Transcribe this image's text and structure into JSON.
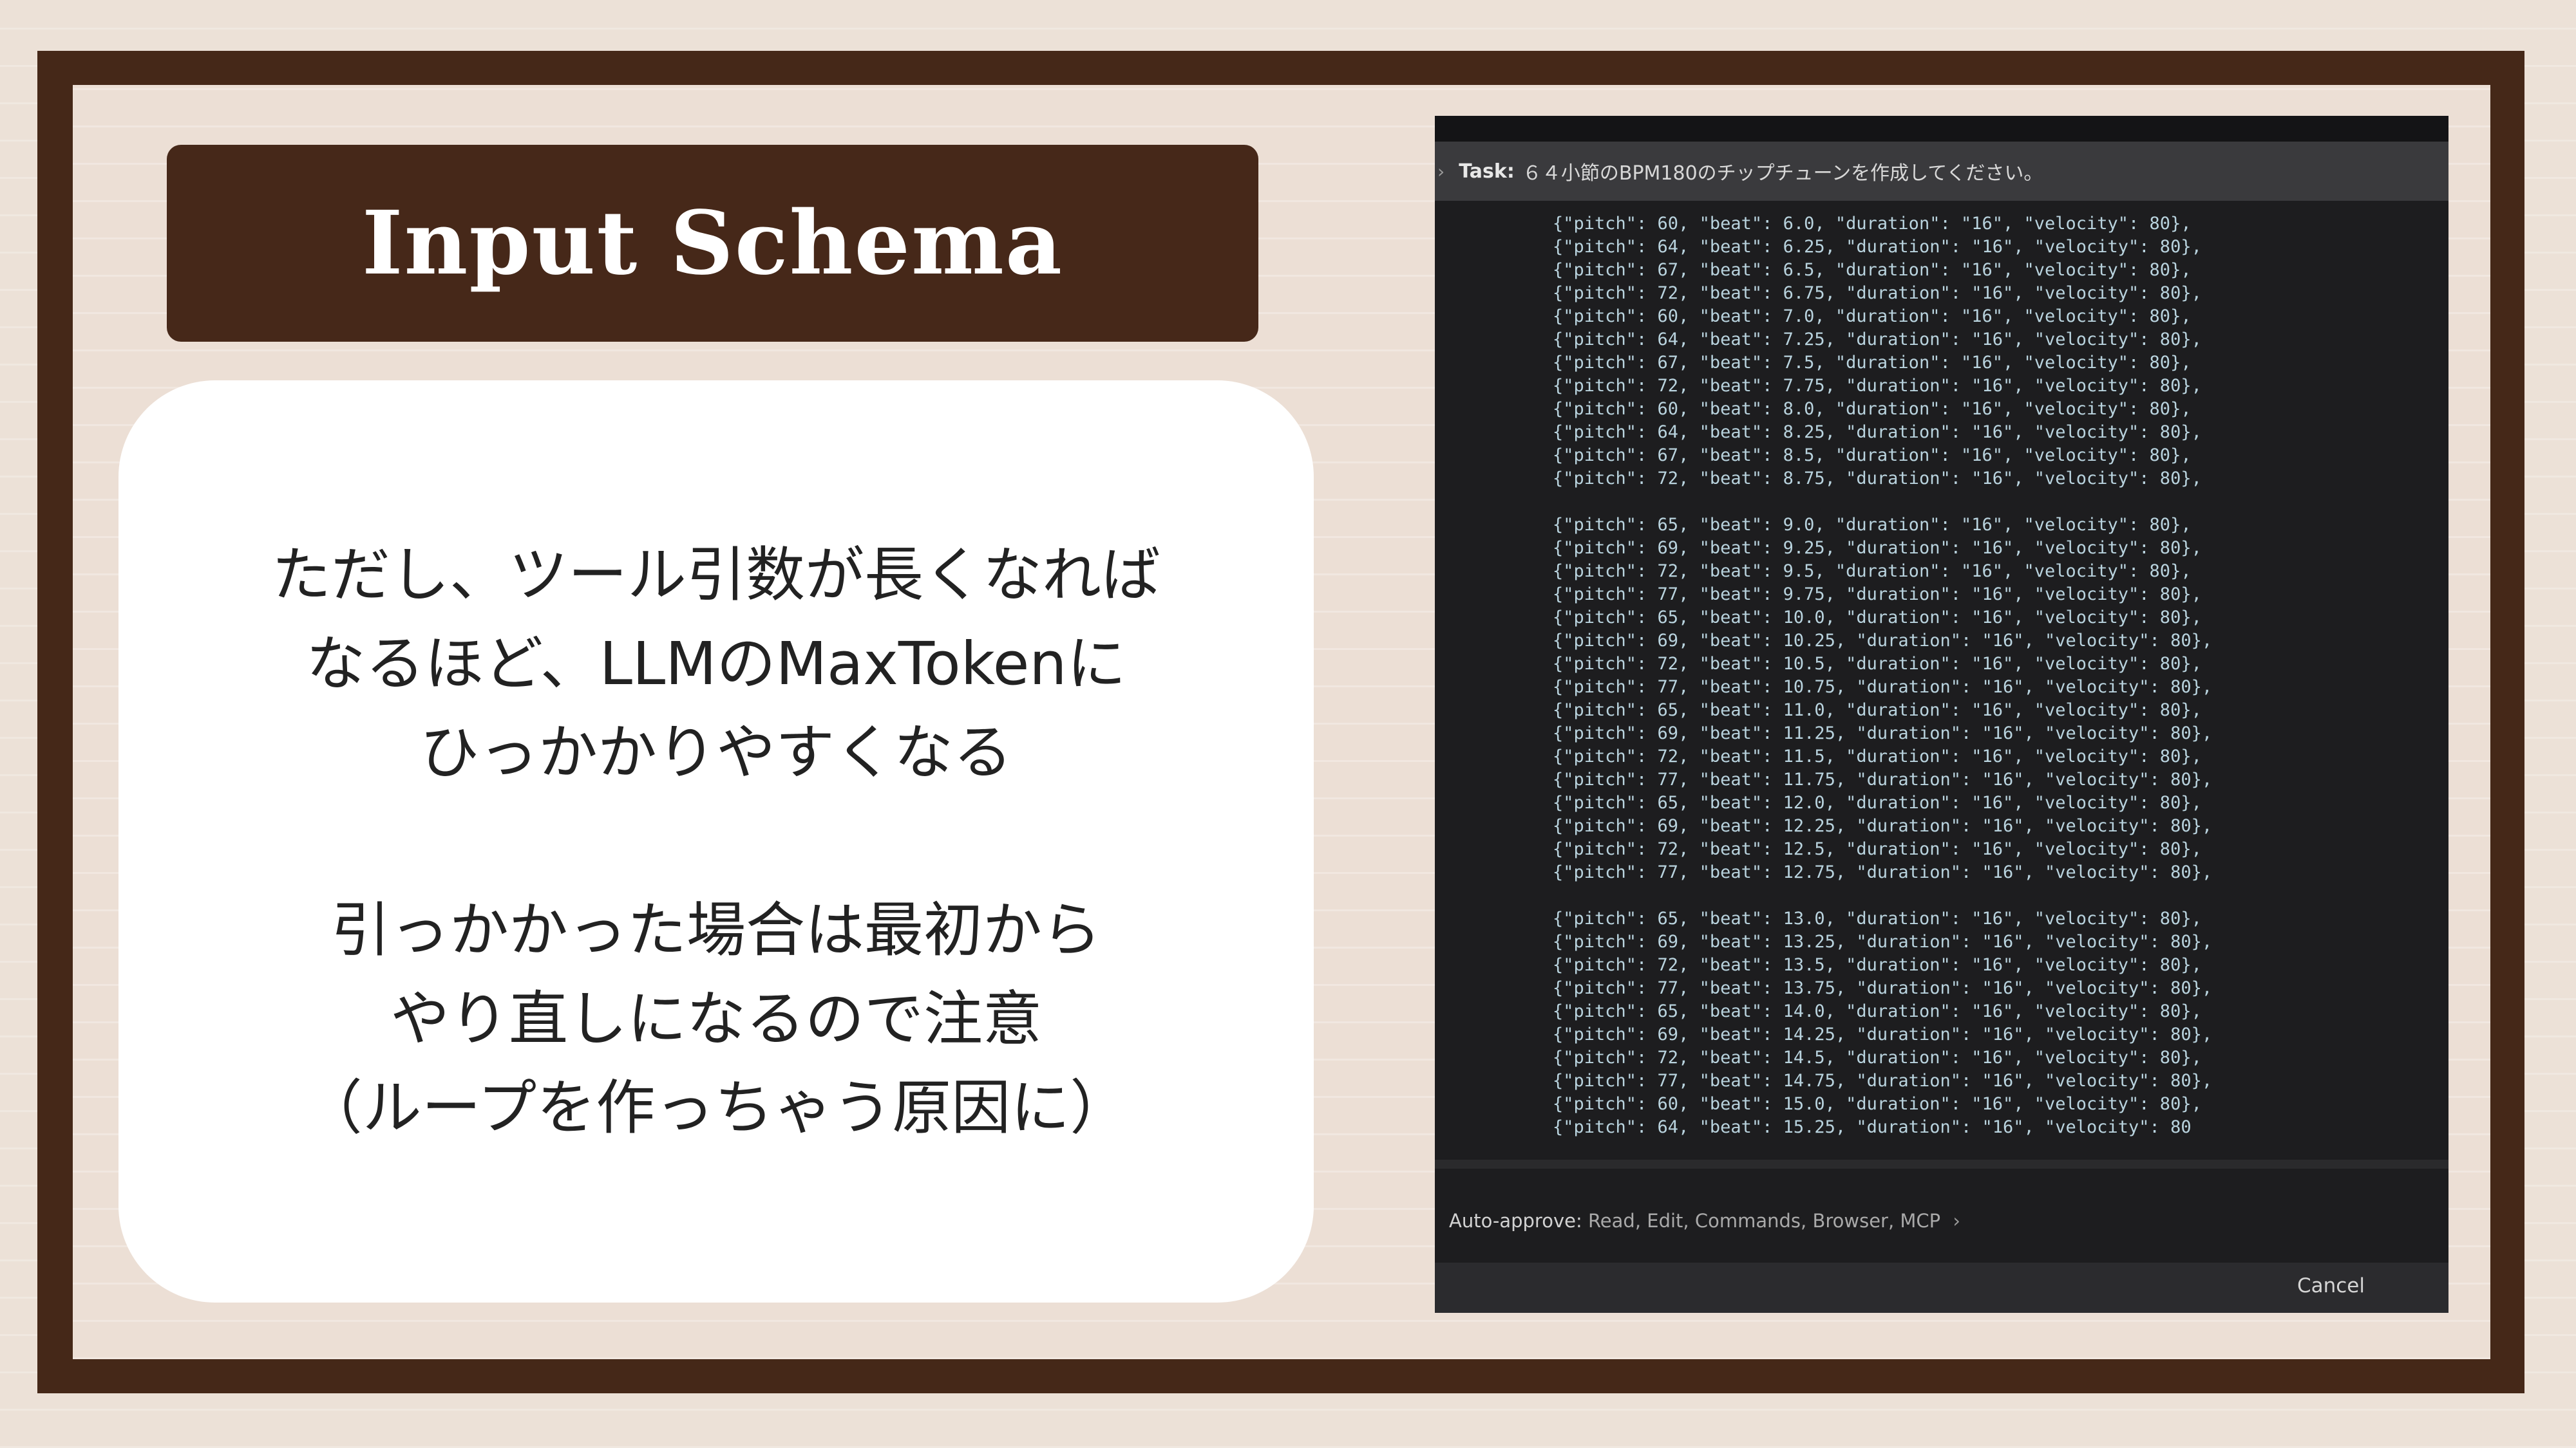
{
  "slide": {
    "title": "Input Schema",
    "note": {
      "paragraph1": [
        "ただし、ツール引数が長くなれば",
        "なるほど、LLMのMaxTokenに",
        "ひっかかりやすくなる"
      ],
      "paragraph2": [
        "引っかかった場合は最初から",
        "やり直しになるので注意",
        "（ループを作っちゃう原因に）"
      ]
    }
  },
  "screenshot": {
    "task_label": "Task:",
    "task_text": "６４小節のBPM180のチップチューンを作成してください。",
    "code_blocks": [
      [
        "{\"pitch\": 60, \"beat\": 6.0, \"duration\": \"16\", \"velocity\": 80},",
        "{\"pitch\": 64, \"beat\": 6.25, \"duration\": \"16\", \"velocity\": 80},",
        "{\"pitch\": 67, \"beat\": 6.5, \"duration\": \"16\", \"velocity\": 80},",
        "{\"pitch\": 72, \"beat\": 6.75, \"duration\": \"16\", \"velocity\": 80},",
        "{\"pitch\": 60, \"beat\": 7.0, \"duration\": \"16\", \"velocity\": 80},",
        "{\"pitch\": 64, \"beat\": 7.25, \"duration\": \"16\", \"velocity\": 80},",
        "{\"pitch\": 67, \"beat\": 7.5, \"duration\": \"16\", \"velocity\": 80},",
        "{\"pitch\": 72, \"beat\": 7.75, \"duration\": \"16\", \"velocity\": 80},",
        "{\"pitch\": 60, \"beat\": 8.0, \"duration\": \"16\", \"velocity\": 80},",
        "{\"pitch\": 64, \"beat\": 8.25, \"duration\": \"16\", \"velocity\": 80},",
        "{\"pitch\": 67, \"beat\": 8.5, \"duration\": \"16\", \"velocity\": 80},",
        "{\"pitch\": 72, \"beat\": 8.75, \"duration\": \"16\", \"velocity\": 80},"
      ],
      [
        "{\"pitch\": 65, \"beat\": 9.0, \"duration\": \"16\", \"velocity\": 80},",
        "{\"pitch\": 69, \"beat\": 9.25, \"duration\": \"16\", \"velocity\": 80},",
        "{\"pitch\": 72, \"beat\": 9.5, \"duration\": \"16\", \"velocity\": 80},",
        "{\"pitch\": 77, \"beat\": 9.75, \"duration\": \"16\", \"velocity\": 80},",
        "{\"pitch\": 65, \"beat\": 10.0, \"duration\": \"16\", \"velocity\": 80},",
        "{\"pitch\": 69, \"beat\": 10.25, \"duration\": \"16\", \"velocity\": 80},",
        "{\"pitch\": 72, \"beat\": 10.5, \"duration\": \"16\", \"velocity\": 80},",
        "{\"pitch\": 77, \"beat\": 10.75, \"duration\": \"16\", \"velocity\": 80},",
        "{\"pitch\": 65, \"beat\": 11.0, \"duration\": \"16\", \"velocity\": 80},",
        "{\"pitch\": 69, \"beat\": 11.25, \"duration\": \"16\", \"velocity\": 80},",
        "{\"pitch\": 72, \"beat\": 11.5, \"duration\": \"16\", \"velocity\": 80},",
        "{\"pitch\": 77, \"beat\": 11.75, \"duration\": \"16\", \"velocity\": 80},",
        "{\"pitch\": 65, \"beat\": 12.0, \"duration\": \"16\", \"velocity\": 80},",
        "{\"pitch\": 69, \"beat\": 12.25, \"duration\": \"16\", \"velocity\": 80},",
        "{\"pitch\": 72, \"beat\": 12.5, \"duration\": \"16\", \"velocity\": 80},",
        "{\"pitch\": 77, \"beat\": 12.75, \"duration\": \"16\", \"velocity\": 80},"
      ],
      [
        "{\"pitch\": 65, \"beat\": 13.0, \"duration\": \"16\", \"velocity\": 80},",
        "{\"pitch\": 69, \"beat\": 13.25, \"duration\": \"16\", \"velocity\": 80},",
        "{\"pitch\": 72, \"beat\": 13.5, \"duration\": \"16\", \"velocity\": 80},",
        "{\"pitch\": 77, \"beat\": 13.75, \"duration\": \"16\", \"velocity\": 80},",
        "{\"pitch\": 65, \"beat\": 14.0, \"duration\": \"16\", \"velocity\": 80},",
        "{\"pitch\": 69, \"beat\": 14.25, \"duration\": \"16\", \"velocity\": 80},",
        "{\"pitch\": 72, \"beat\": 14.5, \"duration\": \"16\", \"velocity\": 80},",
        "{\"pitch\": 77, \"beat\": 14.75, \"duration\": \"16\", \"velocity\": 80},",
        "{\"pitch\": 60, \"beat\": 15.0, \"duration\": \"16\", \"velocity\": 80},",
        "{\"pitch\": 64, \"beat\": 15.25, \"duration\": \"16\", \"velocity\": 80"
      ]
    ],
    "auto_approve_label": "Auto-approve:",
    "auto_approve_value": "Read, Edit, Commands, Browser, MCP",
    "cancel_label": "Cancel"
  },
  "colors": {
    "frame": "#452818",
    "title_box": "#462819",
    "background": "#ece1d7",
    "screenshot_bg": "#1d1d1f",
    "code_text": "#b9d3de"
  },
  "icons": [
    "chevron-right-icon"
  ]
}
